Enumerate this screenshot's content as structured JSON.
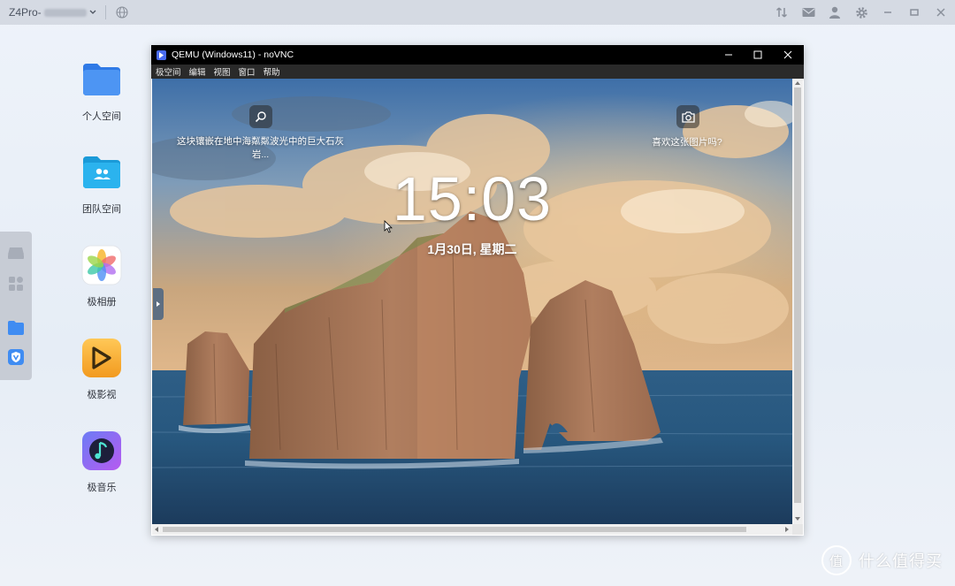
{
  "topbar": {
    "device_name": "Z4Pro-",
    "icons": [
      "globe-icon",
      "transfer-icon",
      "mail-icon",
      "user-icon",
      "gear-icon",
      "minimize-icon",
      "maximize-icon",
      "close-icon"
    ]
  },
  "desktop": {
    "items": [
      {
        "label": "个人空间",
        "icon": "folder-icon"
      },
      {
        "label": "团队空间",
        "icon": "team-folder-icon"
      },
      {
        "label": "极相册",
        "icon": "photos-icon"
      },
      {
        "label": "极影视",
        "icon": "video-icon"
      },
      {
        "label": "极音乐",
        "icon": "music-icon"
      }
    ]
  },
  "dock": {
    "icons": [
      "drive-icon",
      "apps-grid-icon",
      "folder-icon",
      "shield-app-icon"
    ]
  },
  "vnc_window": {
    "title": "QEMU (Windows11) - noVNC",
    "menu": [
      "极空间",
      "编辑",
      "视图",
      "窗口",
      "帮助"
    ]
  },
  "lockscreen": {
    "time": "15:03",
    "date": "1月30日, 星期二",
    "spotlight_left": "这块镶嵌在地中海粼粼波光中的巨大石灰岩...",
    "spotlight_right": "喜欢这张图片吗?"
  },
  "watermark": {
    "text": "什么值得买",
    "logo": "值"
  },
  "colors": {
    "accent": "#3f8cf2",
    "topbar": "#d5dae3",
    "window_title": "#000000"
  }
}
